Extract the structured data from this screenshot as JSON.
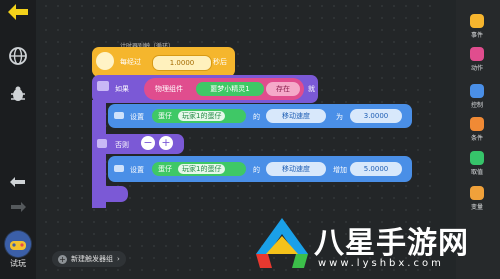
{
  "toolbar": {
    "try_run_label": "试玩"
  },
  "categories": [
    {
      "label": "事件",
      "color": "#f6b52e"
    },
    {
      "label": "动作",
      "color": "#e04d8e"
    },
    {
      "label": "控制",
      "color": "#4a8fe7"
    },
    {
      "label": "条件",
      "color": "#f08a35"
    },
    {
      "label": "取值",
      "color": "#36c46a"
    },
    {
      "label": "变量",
      "color": "#f0a13a"
    }
  ],
  "script": {
    "trigger_caption": "计时器别触（循环）",
    "every_label": "每经过",
    "interval_value": "1.0000",
    "seconds_label": "秒后",
    "if_label": "如果",
    "physics_component_label": "物理组件",
    "sprite_name": "噩梦小精灵1",
    "exists_label": "存在",
    "then_label": "就",
    "set_label_1": "设置",
    "egg_label_1": "蛋仔",
    "player_egg_1": "玩家1的蛋仔",
    "of_label_1": "的",
    "move_speed_1": "移动速度",
    "to_label": "为",
    "speed_value_1": "3.0000",
    "else_label": "否则",
    "set_label_2": "设置",
    "egg_label_2": "蛋仔",
    "player_egg_2": "玩家1的蛋仔",
    "of_label_2": "的",
    "move_speed_2": "移动速度",
    "increase_label": "增加",
    "speed_value_2": "5.0000"
  },
  "add_trigger_label": "新建触发器组",
  "watermark": {
    "brand": "八星手游网",
    "url": "www.lyshbx.com"
  }
}
